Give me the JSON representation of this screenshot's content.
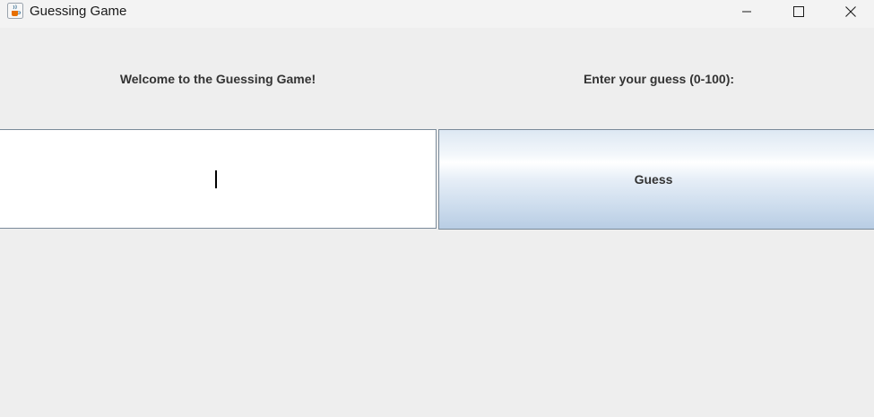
{
  "window": {
    "title": "Guessing Game",
    "app_icon": "java-cup-icon",
    "controls": {
      "minimize_icon": "minimize-icon",
      "maximize_icon": "maximize-icon",
      "close_icon": "close-icon"
    }
  },
  "main": {
    "welcome_label": "Welcome to the Guessing Game!",
    "prompt_label": "Enter your guess (0-100):",
    "guess_input": {
      "value": "",
      "placeholder": ""
    },
    "guess_button_label": "Guess"
  },
  "colors": {
    "background": "#eeeeee",
    "titlebar": "#f3f3f3",
    "button_gradient_top": "#ffffff",
    "button_gradient_bottom": "#b8cde4",
    "border": "#7a8a99",
    "label_text": "#333333"
  }
}
